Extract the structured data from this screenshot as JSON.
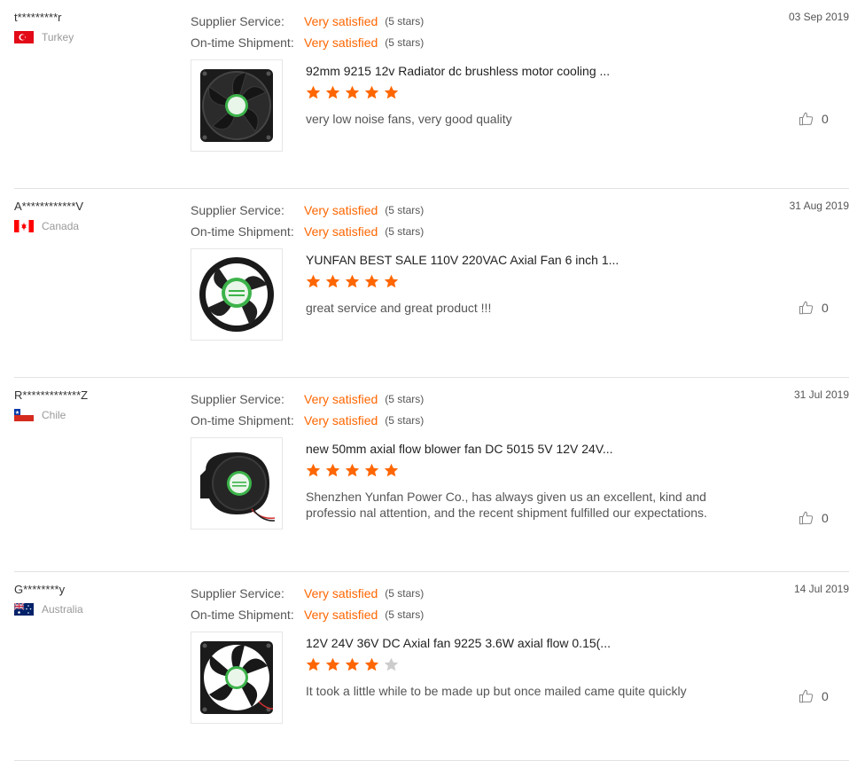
{
  "reviews": [
    {
      "buyer": "t*********r",
      "country": "Turkey",
      "flag_color": "#e30a17",
      "supplier_label": "Supplier Service:",
      "supplier_value": "Very satisfied",
      "supplier_stars": "(5 stars)",
      "shipment_label": "On-time Shipment:",
      "shipment_value": "Very satisfied",
      "shipment_stars": "(5 stars)",
      "date": "03 Sep 2019",
      "product": "92mm 9215 12v Radiator dc brushless motor cooling ...",
      "rating": 5,
      "comment": "very low noise fans, very good quality",
      "likes": "0"
    },
    {
      "buyer": "A************V",
      "country": "Canada",
      "flag_color": "#ff0000",
      "supplier_label": "Supplier Service:",
      "supplier_value": "Very satisfied",
      "supplier_stars": "(5 stars)",
      "shipment_label": "On-time Shipment:",
      "shipment_value": "Very satisfied",
      "shipment_stars": "(5 stars)",
      "date": "31 Aug 2019",
      "product": "YUNFAN BEST SALE 110V 220VAC Axial Fan 6 inch 1...",
      "rating": 5,
      "comment": "great service  and great product  !!!",
      "likes": "0"
    },
    {
      "buyer": "R*************Z",
      "country": "Chile",
      "flag_color": "#d52b1e",
      "supplier_label": "Supplier Service:",
      "supplier_value": "Very satisfied",
      "supplier_stars": "(5 stars)",
      "shipment_label": "On-time Shipment:",
      "shipment_value": "Very satisfied",
      "shipment_stars": "(5 stars)",
      "date": "31 Jul 2019",
      "product": "new 50mm axial flow blower fan DC 5015 5V 12V 24V...",
      "rating": 5,
      "comment": "Shenzhen Yunfan Power Co., has always given us an excellent, kind and professio nal attention, and the recent shipment fulfilled our expectations.",
      "likes": "0"
    },
    {
      "buyer": "G********y",
      "country": "Australia",
      "flag_color": "#012169",
      "supplier_label": "Supplier Service:",
      "supplier_value": "Very satisfied",
      "supplier_stars": "(5 stars)",
      "shipment_label": "On-time Shipment:",
      "shipment_value": "Very satisfied",
      "shipment_stars": "(5 stars)",
      "date": "14 Jul 2019",
      "product": "12V 24V 36V DC Axial fan 9225 3.6W axial flow 0.15(...",
      "rating": 4,
      "comment": "It took a little while to be made up but once mailed came quite quickly",
      "likes": "0"
    }
  ],
  "colors": {
    "accent": "#ff6600",
    "star_filled": "#ff6600",
    "star_empty": "#cccccc"
  }
}
